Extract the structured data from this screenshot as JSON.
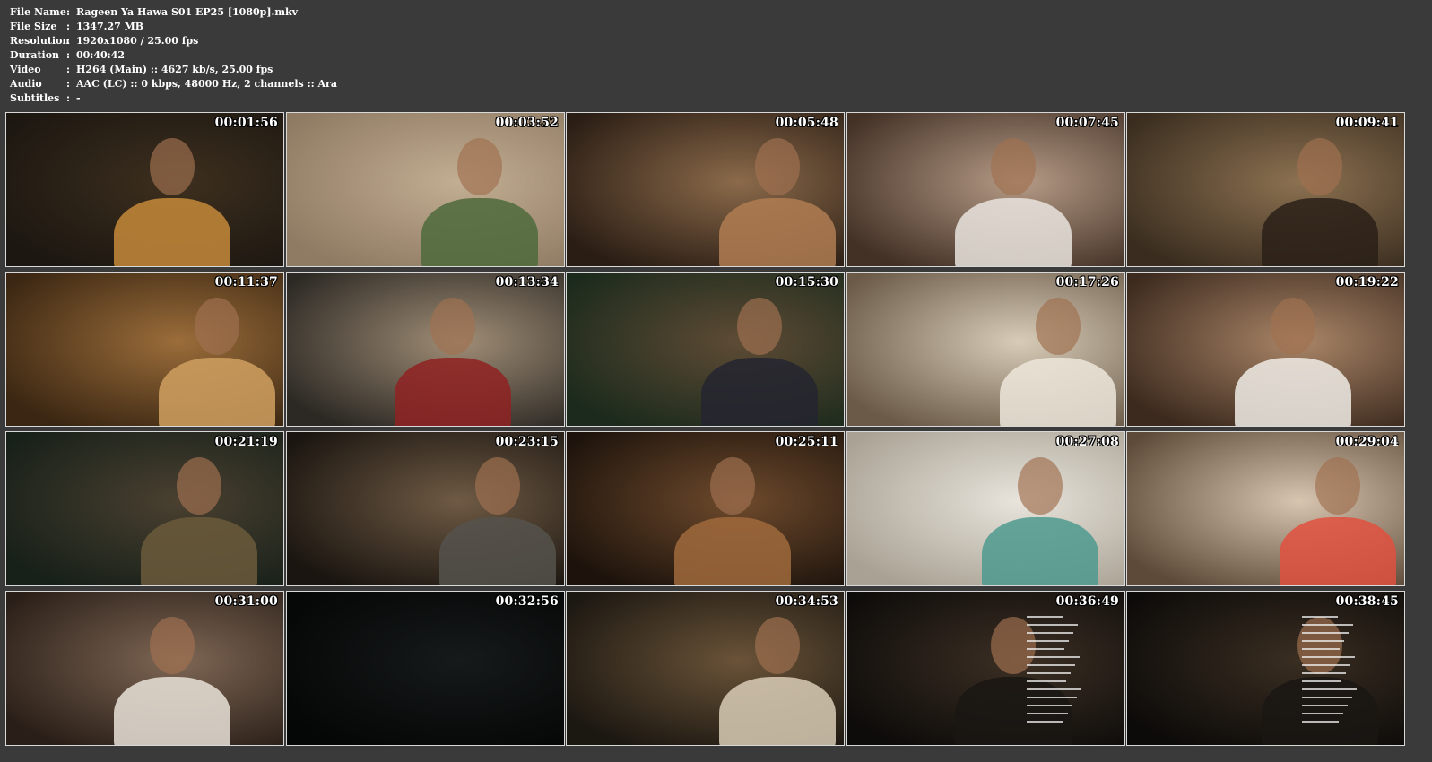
{
  "info": [
    {
      "label": "File Name",
      "sep": ":",
      "value": "Rageen Ya Hawa S01 EP25 [1080p].mkv"
    },
    {
      "label": "File Size",
      "sep": ":",
      "value": "1347.27 MB"
    },
    {
      "label": "Resolution",
      "sep": ":",
      "value": "1920x1080 / 25.00 fps"
    },
    {
      "label": "Duration",
      "sep": ":",
      "value": "00:40:42"
    },
    {
      "label": "Video",
      "sep": ":",
      "value": "H264 (Main) :: 4627 kb/s, 25.00 fps"
    },
    {
      "label": "Audio",
      "sep": ":",
      "value": "AAC (LC) :: 0 kbps, 48000 Hz, 2 channels :: Ara"
    },
    {
      "label": "Subtitles",
      "sep": ":",
      "value": "-"
    }
  ],
  "thumbnails": [
    {
      "timestamp": "00:01:56",
      "bg": [
        "#1c1711",
        "#3d2f1e"
      ],
      "accent": "#c68a3a"
    },
    {
      "timestamp": "00:03:52",
      "bg": [
        "#8f7a63",
        "#c2ae92"
      ],
      "accent": "#4d6a3b"
    },
    {
      "timestamp": "00:05:48",
      "bg": [
        "#2a1d14",
        "#8b6a4a"
      ],
      "accent": "#b07d52"
    },
    {
      "timestamp": "00:07:45",
      "bg": [
        "#433126",
        "#b59b86"
      ],
      "accent": "#e9e4de"
    },
    {
      "timestamp": "00:09:41",
      "bg": [
        "#3a2d1f",
        "#8c7151"
      ],
      "accent": "#2a2018"
    },
    {
      "timestamp": "00:11:37",
      "bg": [
        "#3a2612",
        "#9b6d3a"
      ],
      "accent": "#d0a060"
    },
    {
      "timestamp": "00:13:34",
      "bg": [
        "#2c2924",
        "#a08d76"
      ],
      "accent": "#8f2222"
    },
    {
      "timestamp": "00:15:30",
      "bg": [
        "#1b2a1c",
        "#5e4b35"
      ],
      "accent": "#242430"
    },
    {
      "timestamp": "00:17:26",
      "bg": [
        "#6a5a47",
        "#d8ccb8"
      ],
      "accent": "#ece6da"
    },
    {
      "timestamp": "00:19:22",
      "bg": [
        "#3c2a1e",
        "#a98567"
      ],
      "accent": "#f0ece6"
    },
    {
      "timestamp": "00:21:19",
      "bg": [
        "#172019",
        "#4a4030"
      ],
      "accent": "#6b5a3b"
    },
    {
      "timestamp": "00:23:15",
      "bg": [
        "#1a1510",
        "#6f5a44"
      ],
      "accent": "#55524c"
    },
    {
      "timestamp": "00:25:11",
      "bg": [
        "#1d130c",
        "#6e4a2c"
      ],
      "accent": "#a06a3c"
    },
    {
      "timestamp": "00:27:08",
      "bg": [
        "#a9a294",
        "#e8e4dc"
      ],
      "accent": "#4e9a8e"
    },
    {
      "timestamp": "00:29:04",
      "bg": [
        "#5d4a38",
        "#d8c5b0"
      ],
      "accent": "#e0503e"
    },
    {
      "timestamp": "00:31:00",
      "bg": [
        "#2a1f18",
        "#7e6654"
      ],
      "accent": "#e9e2d8"
    },
    {
      "timestamp": "00:32:56",
      "bg": [
        "#050606",
        "#161a1a"
      ],
      "accent": "#202626"
    },
    {
      "timestamp": "00:34:53",
      "bg": [
        "#1b1711",
        "#6a5338"
      ],
      "accent": "#d9cdb6"
    },
    {
      "timestamp": "00:36:49",
      "bg": [
        "#0e0c0a",
        "#3c2f24"
      ],
      "accent": "#1a1613"
    },
    {
      "timestamp": "00:38:45",
      "bg": [
        "#0d0b09",
        "#3a2e22"
      ],
      "accent": "#1a1613"
    }
  ]
}
